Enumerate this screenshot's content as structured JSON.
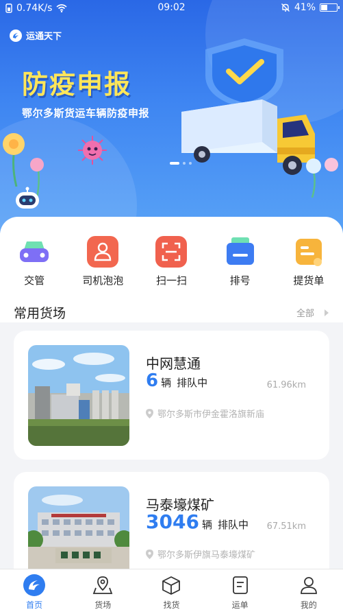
{
  "status_bar": {
    "speed": "0.74K/s",
    "time": "09:02",
    "battery": "41%",
    "battery_level": 0.41
  },
  "banner": {
    "brand": "运通天下",
    "title": "防疫申报",
    "subtitle": "鄂尔多斯货运车辆防疫申报",
    "slides": 3,
    "active_slide": 1
  },
  "menu": [
    {
      "label": "交管",
      "icon": "car-icon",
      "color": "#7e6ff5"
    },
    {
      "label": "司机泡泡",
      "icon": "driver-icon",
      "color": "#f2674f"
    },
    {
      "label": "扫一扫",
      "icon": "scan-icon",
      "color": "#f0614e"
    },
    {
      "label": "排号",
      "icon": "queue-number-icon",
      "color": "#3d7cf2"
    },
    {
      "label": "提货单",
      "icon": "bill-icon",
      "color": "#f7b43c"
    }
  ],
  "section": {
    "title": "常用货场",
    "more": "全部"
  },
  "yards": [
    {
      "name": "中网慧通",
      "count": "6",
      "unit": "辆",
      "status": "排队中",
      "distance": "61.96km",
      "address": "鄂尔多斯市伊金霍洛旗新庙"
    },
    {
      "name": "马泰壕煤矿",
      "count": "3046",
      "unit": "辆",
      "status": "排队中",
      "distance": "67.51km",
      "address": "鄂尔多斯伊旗马泰壕煤矿"
    }
  ],
  "tabs": [
    {
      "label": "首页",
      "icon": "home-icon",
      "active": true
    },
    {
      "label": "货场",
      "icon": "map-pin-icon",
      "active": false
    },
    {
      "label": "找货",
      "icon": "box-icon",
      "active": false
    },
    {
      "label": "运单",
      "icon": "waybill-icon",
      "active": false
    },
    {
      "label": "我的",
      "icon": "user-icon",
      "active": false
    }
  ],
  "colors": {
    "accent": "#2f7df0",
    "banner_title": "#ffe65a",
    "banner_bg": "#3f86f2"
  }
}
